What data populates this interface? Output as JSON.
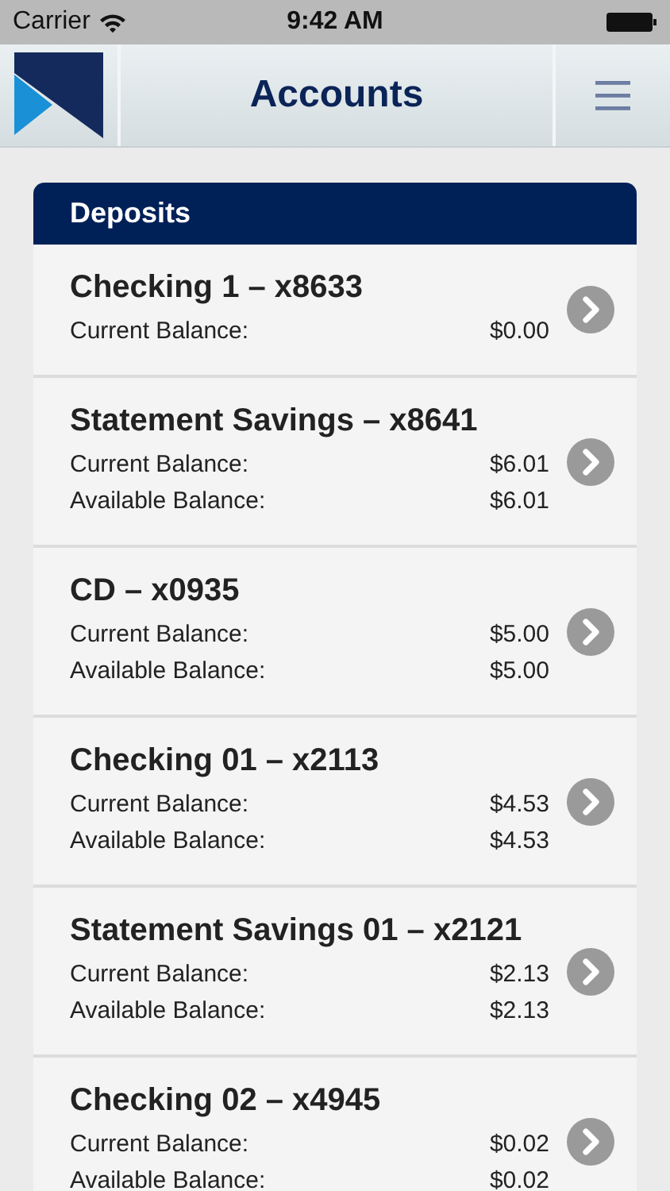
{
  "status_bar": {
    "carrier": "Carrier",
    "time": "9:42 AM"
  },
  "header": {
    "title": "Accounts"
  },
  "section": {
    "title": "Deposits",
    "accounts": [
      {
        "name": "Checking 1 – x8633",
        "balances": [
          {
            "label": "Current Balance:",
            "amount": "$0.00"
          }
        ]
      },
      {
        "name": "Statement Savings – x8641",
        "balances": [
          {
            "label": "Current Balance:",
            "amount": "$6.01"
          },
          {
            "label": "Available Balance:",
            "amount": "$6.01"
          }
        ]
      },
      {
        "name": "CD – x0935",
        "balances": [
          {
            "label": "Current Balance:",
            "amount": "$5.00"
          },
          {
            "label": "Available Balance:",
            "amount": "$5.00"
          }
        ]
      },
      {
        "name": "Checking 01 – x2113",
        "balances": [
          {
            "label": "Current Balance:",
            "amount": "$4.53"
          },
          {
            "label": "Available Balance:",
            "amount": "$4.53"
          }
        ]
      },
      {
        "name": "Statement Savings 01 – x2121",
        "balances": [
          {
            "label": "Current Balance:",
            "amount": "$2.13"
          },
          {
            "label": "Available Balance:",
            "amount": "$2.13"
          }
        ]
      },
      {
        "name": "Checking 02 – x4945",
        "balances": [
          {
            "label": "Current Balance:",
            "amount": "$0.02"
          },
          {
            "label": "Available Balance:",
            "amount": "$0.02"
          }
        ]
      }
    ]
  }
}
